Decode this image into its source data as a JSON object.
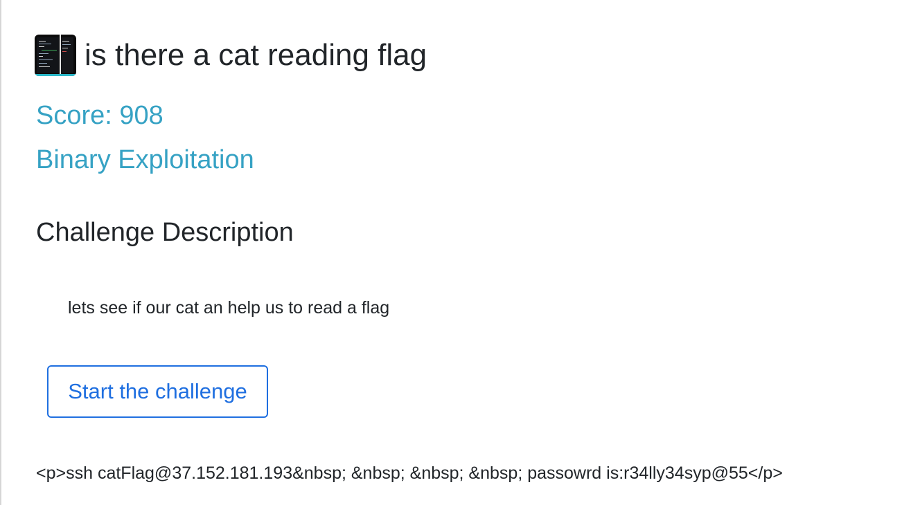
{
  "challenge": {
    "thumbnail_icon": "terminal-screenshot-thumbnail",
    "title": "is there a cat reading flag",
    "score": "Score: 908",
    "category": "Binary Exploitation"
  },
  "description": {
    "heading": "Challenge Description",
    "text": "lets see if our cat an help us to read a flag"
  },
  "actions": {
    "start_label": "Start the challenge"
  },
  "connection_info": "<p>ssh catFlag@37.152.181.193&nbsp; &nbsp; &nbsp; &nbsp; passowrd is:r34lly34syp@55</p>",
  "colors": {
    "accent": "#36a2c4",
    "button": "#1f6fe0",
    "text": "#212529"
  }
}
